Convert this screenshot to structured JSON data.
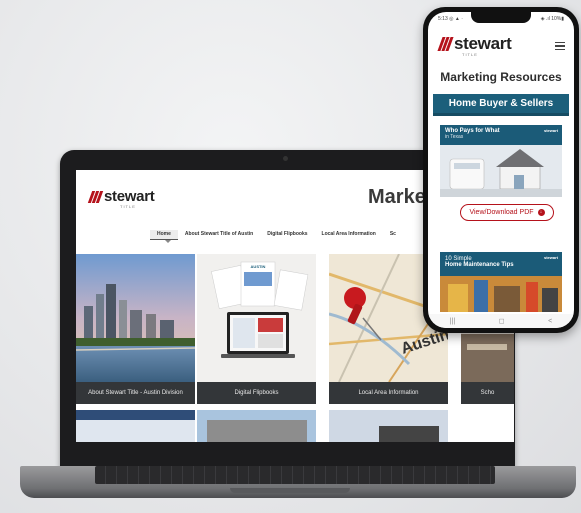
{
  "laptop": {
    "site": {
      "brand": "stewart",
      "brand_sub": "TITLE",
      "title": "Market",
      "nav": [
        {
          "label": "Home",
          "active": true
        },
        {
          "label": "About Stewart Title of Austin"
        },
        {
          "label": "Digital Flipbooks"
        },
        {
          "label": "Local Area Information"
        },
        {
          "label": "Sc"
        }
      ],
      "tiles": [
        {
          "caption": "About Stewart Title - Austin Division"
        },
        {
          "caption": "Digital Flipbooks"
        },
        {
          "caption": "Local Area Information"
        },
        {
          "caption": "Scho"
        }
      ],
      "flipbook_text": "AUSTIN",
      "map_text": "Austin"
    }
  },
  "phone": {
    "status_left": "5:13 ◎ ▲ ·",
    "status_right": "◈ .ıl 10%▮",
    "brand": "stewart",
    "brand_sub": "TITLE",
    "page_title": "Marketing Resources",
    "banner": "Home Buyer & Sellers",
    "card1": {
      "title": "Who Pays for What",
      "subtitle": "in Texas",
      "brand": "stewart"
    },
    "pdf_button": "View/Download PDF",
    "card2": {
      "title": "10 Simple",
      "subtitle": "Home Maintenance Tips",
      "brand": "stewart"
    },
    "nav_buttons": [
      "|||",
      "◻",
      "<"
    ]
  },
  "colors": {
    "brand_red": "#b5121b",
    "banner_teal": "#1c5f7b",
    "caption_bar": "#333639"
  }
}
